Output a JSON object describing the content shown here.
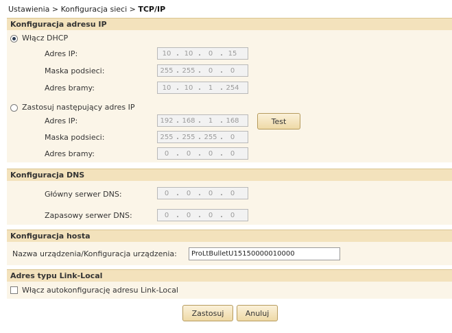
{
  "breadcrumb": {
    "path": "Ustawienia > Konfiguracja sieci > ",
    "current": "TCP/IP"
  },
  "ip_section": {
    "title": "Konfiguracja adresu IP",
    "dhcp": {
      "label": "Włącz DHCP",
      "selected": true,
      "ip_label": "Adres IP:",
      "ip": [
        "10",
        "10",
        "0",
        "15"
      ],
      "mask_label": "Maska podsieci:",
      "mask": [
        "255",
        "255",
        "0",
        "0"
      ],
      "gw_label": "Adres bramy:",
      "gw": [
        "10",
        "10",
        "1",
        "254"
      ]
    },
    "static": {
      "label": "Zastosuj następujący adres IP",
      "selected": false,
      "ip_label": "Adres IP:",
      "ip": [
        "192",
        "168",
        "1",
        "168"
      ],
      "mask_label": "Maska podsieci:",
      "mask": [
        "255",
        "255",
        "255",
        "0"
      ],
      "gw_label": "Adres bramy:",
      "gw": [
        "0",
        "0",
        "0",
        "0"
      ],
      "test_label": "Test"
    }
  },
  "dns_section": {
    "title": "Konfiguracja DNS",
    "primary_label": "Główny serwer DNS:",
    "primary": [
      "0",
      "0",
      "0",
      "0"
    ],
    "secondary_label": "Zapasowy serwer DNS:",
    "secondary": [
      "0",
      "0",
      "0",
      "0"
    ]
  },
  "host_section": {
    "title": "Konfiguracja hosta",
    "name_label": "Nazwa urządzenia/Konfiguracja urządzenia:",
    "name_value": "ProLtBulletU15150000010000"
  },
  "linklocal_section": {
    "title": "Adres typu Link-Local",
    "checkbox_label": "Włącz autokonfigurację adresu Link-Local",
    "checked": false
  },
  "actions": {
    "apply_label": "Zastosuj",
    "cancel_label": "Anuluj"
  }
}
